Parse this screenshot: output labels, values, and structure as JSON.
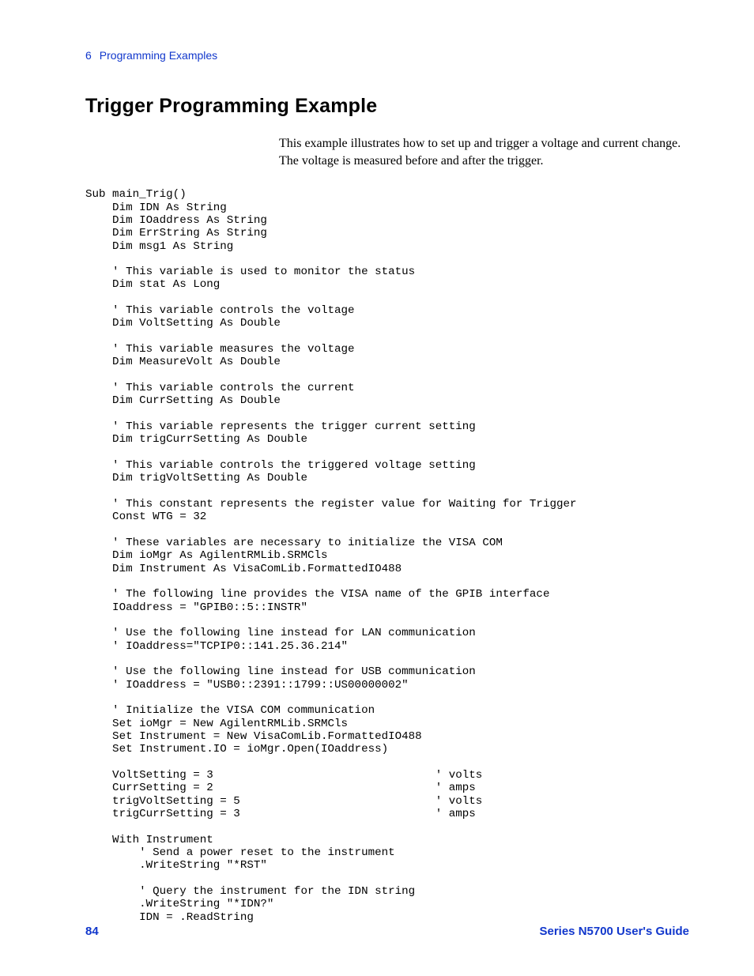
{
  "header": {
    "chapter_number": "6",
    "chapter_title": "Programming Examples"
  },
  "section": {
    "title": "Trigger Programming Example",
    "intro": "This example illustrates how to set up and trigger a voltage and current change. The voltage is measured before and after the trigger."
  },
  "code": "Sub main_Trig()\n    Dim IDN As String\n    Dim IOaddress As String\n    Dim ErrString As String\n    Dim msg1 As String\n\n    ' This variable is used to monitor the status\n    Dim stat As Long\n\n    ' This variable controls the voltage\n    Dim VoltSetting As Double\n\n    ' This variable measures the voltage\n    Dim MeasureVolt As Double\n\n    ' This variable controls the current\n    Dim CurrSetting As Double\n\n    ' This variable represents the trigger current setting\n    Dim trigCurrSetting As Double\n\n    ' This variable controls the triggered voltage setting\n    Dim trigVoltSetting As Double\n\n    ' This constant represents the register value for Waiting for Trigger\n    Const WTG = 32\n\n    ' These variables are necessary to initialize the VISA COM\n    Dim ioMgr As AgilentRMLib.SRMCls\n    Dim Instrument As VisaComLib.FormattedIO488\n\n    ' The following line provides the VISA name of the GPIB interface\n    IOaddress = \"GPIB0::5::INSTR\"\n\n    ' Use the following line instead for LAN communication\n    ' IOaddress=\"TCPIP0::141.25.36.214\"\n\n    ' Use the following line instead for USB communication\n    ' IOaddress = \"USB0::2391::1799::US00000002\"\n\n    ' Initialize the VISA COM communication\n    Set ioMgr = New AgilentRMLib.SRMCls\n    Set Instrument = New VisaComLib.FormattedIO488\n    Set Instrument.IO = ioMgr.Open(IOaddress)\n\n    VoltSetting = 3                                 ' volts\n    CurrSetting = 2                                 ' amps\n    trigVoltSetting = 5                             ' volts\n    trigCurrSetting = 3                             ' amps\n\n    With Instrument\n        ' Send a power reset to the instrument\n        .WriteString \"*RST\"\n\n        ' Query the instrument for the IDN string\n        .WriteString \"*IDN?\"\n        IDN = .ReadString",
  "footer": {
    "page_number": "84",
    "book_title": "Series N5700 User's Guide"
  }
}
